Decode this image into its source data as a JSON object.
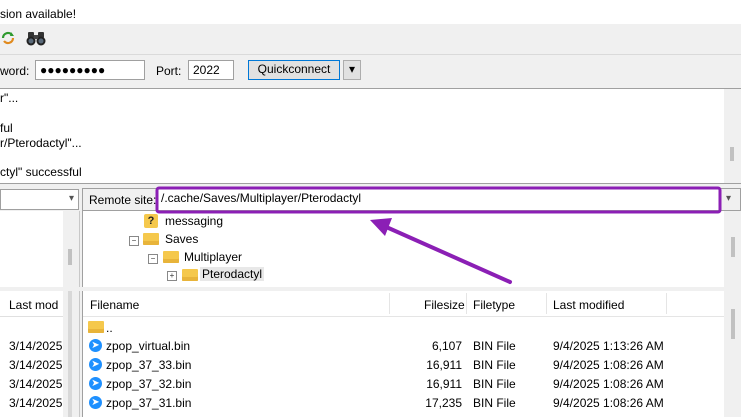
{
  "banner": {
    "text": "sion available!"
  },
  "quickconnect": {
    "password_label": "word:",
    "password_value": "●●●●●●●●●",
    "port_label": "Port:",
    "port_value": "2022",
    "button_label": "Quickconnect",
    "dropdown_glyph": "▾"
  },
  "log": {
    "lines": [
      "r\"...",
      "",
      "ful",
      "r/Pterodactyl\"...",
      "",
      "ctyl\" successful"
    ]
  },
  "remote": {
    "label": "Remote site:",
    "path": "/.cache/Saves/Multiplayer/Pterodactyl",
    "tree": [
      {
        "name": "messaging",
        "icon": "?"
      },
      {
        "name": "Saves"
      },
      {
        "name": "Multiplayer"
      },
      {
        "name": "Pterodactyl"
      }
    ],
    "columns": {
      "filename": "Filename",
      "filesize": "Filesize",
      "filetype": "Filetype",
      "modified": "Last modified"
    },
    "files": [
      {
        "name": "..",
        "size": "",
        "type": "",
        "modified": ""
      },
      {
        "name": "zpop_virtual.bin",
        "size": "6,107",
        "type": "BIN File",
        "modified": "9/4/2025 1:13:26 AM"
      },
      {
        "name": "zpop_37_33.bin",
        "size": "16,911",
        "type": "BIN File",
        "modified": "9/4/2025 1:08:26 AM"
      },
      {
        "name": "zpop_37_32.bin",
        "size": "16,911",
        "type": "BIN File",
        "modified": "9/4/2025 1:08:26 AM"
      },
      {
        "name": "zpop_37_31.bin",
        "size": "17,235",
        "type": "BIN File",
        "modified": "9/4/2025 1:08:26 AM"
      }
    ]
  },
  "local": {
    "column_modified": "Last mod",
    "dates": [
      "3/14/2025",
      "3/14/2025",
      "3/14/2025",
      "3/14/2025"
    ]
  },
  "annotation": {
    "color": "#8b1fb5"
  }
}
